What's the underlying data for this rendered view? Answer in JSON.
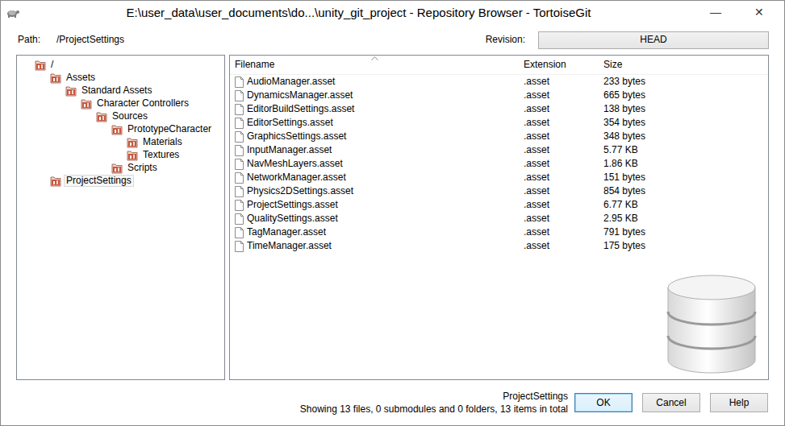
{
  "window": {
    "title": "E:\\user_data\\user_documents\\do...\\unity_git_project - Repository Browser - TortoiseGit",
    "controls": [
      "—",
      "✕"
    ]
  },
  "path": {
    "label": "Path:",
    "value": "/ProjectSettings"
  },
  "revision": {
    "label": "Revision:",
    "value": "HEAD"
  },
  "tree": {
    "label": "/",
    "selected": false,
    "children": [
      {
        "label": "Assets",
        "selected": false,
        "children": [
          {
            "label": "Standard Assets",
            "selected": false,
            "children": [
              {
                "label": "Character Controllers",
                "selected": false,
                "children": [
                  {
                    "label": "Sources",
                    "selected": false,
                    "children": [
                      {
                        "label": "PrototypeCharacter",
                        "selected": false,
                        "children": [
                          {
                            "label": "Materials",
                            "selected": false,
                            "children": []
                          },
                          {
                            "label": "Textures",
                            "selected": false,
                            "children": []
                          }
                        ]
                      },
                      {
                        "label": "Scripts",
                        "selected": false,
                        "children": []
                      }
                    ]
                  }
                ]
              }
            ]
          }
        ]
      },
      {
        "label": "ProjectSettings",
        "selected": true,
        "children": []
      }
    ]
  },
  "table": {
    "columns": [
      "Filename",
      "Extension",
      "Size"
    ],
    "rows": [
      [
        "AudioManager.asset",
        ".asset",
        "233 bytes"
      ],
      [
        "DynamicsManager.asset",
        ".asset",
        "665 bytes"
      ],
      [
        "EditorBuildSettings.asset",
        ".asset",
        "138 bytes"
      ],
      [
        "EditorSettings.asset",
        ".asset",
        "354 bytes"
      ],
      [
        "GraphicsSettings.asset",
        ".asset",
        "348 bytes"
      ],
      [
        "InputManager.asset",
        ".asset",
        "5.77 KB"
      ],
      [
        "NavMeshLayers.asset",
        ".asset",
        "1.86 KB"
      ],
      [
        "NetworkManager.asset",
        ".asset",
        "151 bytes"
      ],
      [
        "Physics2DSettings.asset",
        ".asset",
        "854 bytes"
      ],
      [
        "ProjectSettings.asset",
        ".asset",
        "6.77 KB"
      ],
      [
        "QualitySettings.asset",
        ".asset",
        "2.95 KB"
      ],
      [
        "TagManager.asset",
        ".asset",
        "791 bytes"
      ],
      [
        "TimeManager.asset",
        ".asset",
        "175 bytes"
      ]
    ]
  },
  "status": {
    "path": "ProjectSettings",
    "summary": "Showing 13 files, 0 submodules and 0 folders, 13 items in total"
  },
  "buttons": [
    {
      "label": "OK",
      "default": true
    },
    {
      "label": "Cancel",
      "default": false
    },
    {
      "label": "Help",
      "default": false
    }
  ]
}
